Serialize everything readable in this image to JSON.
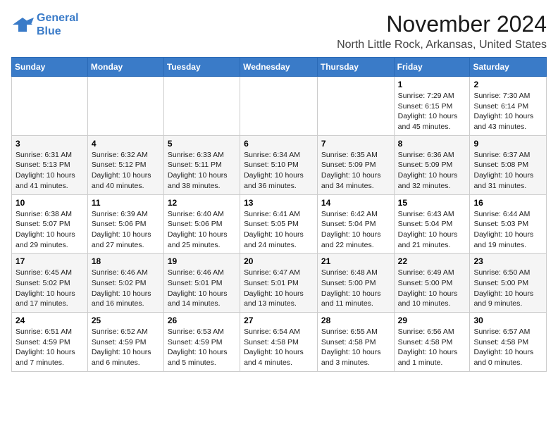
{
  "logo": {
    "line1": "General",
    "line2": "Blue"
  },
  "title": "November 2024",
  "location": "North Little Rock, Arkansas, United States",
  "weekdays": [
    "Sunday",
    "Monday",
    "Tuesday",
    "Wednesday",
    "Thursday",
    "Friday",
    "Saturday"
  ],
  "weeks": [
    [
      {
        "day": "",
        "info": ""
      },
      {
        "day": "",
        "info": ""
      },
      {
        "day": "",
        "info": ""
      },
      {
        "day": "",
        "info": ""
      },
      {
        "day": "",
        "info": ""
      },
      {
        "day": "1",
        "info": "Sunrise: 7:29 AM\nSunset: 6:15 PM\nDaylight: 10 hours and 45 minutes."
      },
      {
        "day": "2",
        "info": "Sunrise: 7:30 AM\nSunset: 6:14 PM\nDaylight: 10 hours and 43 minutes."
      }
    ],
    [
      {
        "day": "3",
        "info": "Sunrise: 6:31 AM\nSunset: 5:13 PM\nDaylight: 10 hours and 41 minutes."
      },
      {
        "day": "4",
        "info": "Sunrise: 6:32 AM\nSunset: 5:12 PM\nDaylight: 10 hours and 40 minutes."
      },
      {
        "day": "5",
        "info": "Sunrise: 6:33 AM\nSunset: 5:11 PM\nDaylight: 10 hours and 38 minutes."
      },
      {
        "day": "6",
        "info": "Sunrise: 6:34 AM\nSunset: 5:10 PM\nDaylight: 10 hours and 36 minutes."
      },
      {
        "day": "7",
        "info": "Sunrise: 6:35 AM\nSunset: 5:09 PM\nDaylight: 10 hours and 34 minutes."
      },
      {
        "day": "8",
        "info": "Sunrise: 6:36 AM\nSunset: 5:09 PM\nDaylight: 10 hours and 32 minutes."
      },
      {
        "day": "9",
        "info": "Sunrise: 6:37 AM\nSunset: 5:08 PM\nDaylight: 10 hours and 31 minutes."
      }
    ],
    [
      {
        "day": "10",
        "info": "Sunrise: 6:38 AM\nSunset: 5:07 PM\nDaylight: 10 hours and 29 minutes."
      },
      {
        "day": "11",
        "info": "Sunrise: 6:39 AM\nSunset: 5:06 PM\nDaylight: 10 hours and 27 minutes."
      },
      {
        "day": "12",
        "info": "Sunrise: 6:40 AM\nSunset: 5:06 PM\nDaylight: 10 hours and 25 minutes."
      },
      {
        "day": "13",
        "info": "Sunrise: 6:41 AM\nSunset: 5:05 PM\nDaylight: 10 hours and 24 minutes."
      },
      {
        "day": "14",
        "info": "Sunrise: 6:42 AM\nSunset: 5:04 PM\nDaylight: 10 hours and 22 minutes."
      },
      {
        "day": "15",
        "info": "Sunrise: 6:43 AM\nSunset: 5:04 PM\nDaylight: 10 hours and 21 minutes."
      },
      {
        "day": "16",
        "info": "Sunrise: 6:44 AM\nSunset: 5:03 PM\nDaylight: 10 hours and 19 minutes."
      }
    ],
    [
      {
        "day": "17",
        "info": "Sunrise: 6:45 AM\nSunset: 5:02 PM\nDaylight: 10 hours and 17 minutes."
      },
      {
        "day": "18",
        "info": "Sunrise: 6:46 AM\nSunset: 5:02 PM\nDaylight: 10 hours and 16 minutes."
      },
      {
        "day": "19",
        "info": "Sunrise: 6:46 AM\nSunset: 5:01 PM\nDaylight: 10 hours and 14 minutes."
      },
      {
        "day": "20",
        "info": "Sunrise: 6:47 AM\nSunset: 5:01 PM\nDaylight: 10 hours and 13 minutes."
      },
      {
        "day": "21",
        "info": "Sunrise: 6:48 AM\nSunset: 5:00 PM\nDaylight: 10 hours and 11 minutes."
      },
      {
        "day": "22",
        "info": "Sunrise: 6:49 AM\nSunset: 5:00 PM\nDaylight: 10 hours and 10 minutes."
      },
      {
        "day": "23",
        "info": "Sunrise: 6:50 AM\nSunset: 5:00 PM\nDaylight: 10 hours and 9 minutes."
      }
    ],
    [
      {
        "day": "24",
        "info": "Sunrise: 6:51 AM\nSunset: 4:59 PM\nDaylight: 10 hours and 7 minutes."
      },
      {
        "day": "25",
        "info": "Sunrise: 6:52 AM\nSunset: 4:59 PM\nDaylight: 10 hours and 6 minutes."
      },
      {
        "day": "26",
        "info": "Sunrise: 6:53 AM\nSunset: 4:59 PM\nDaylight: 10 hours and 5 minutes."
      },
      {
        "day": "27",
        "info": "Sunrise: 6:54 AM\nSunset: 4:58 PM\nDaylight: 10 hours and 4 minutes."
      },
      {
        "day": "28",
        "info": "Sunrise: 6:55 AM\nSunset: 4:58 PM\nDaylight: 10 hours and 3 minutes."
      },
      {
        "day": "29",
        "info": "Sunrise: 6:56 AM\nSunset: 4:58 PM\nDaylight: 10 hours and 1 minute."
      },
      {
        "day": "30",
        "info": "Sunrise: 6:57 AM\nSunset: 4:58 PM\nDaylight: 10 hours and 0 minutes."
      }
    ]
  ]
}
